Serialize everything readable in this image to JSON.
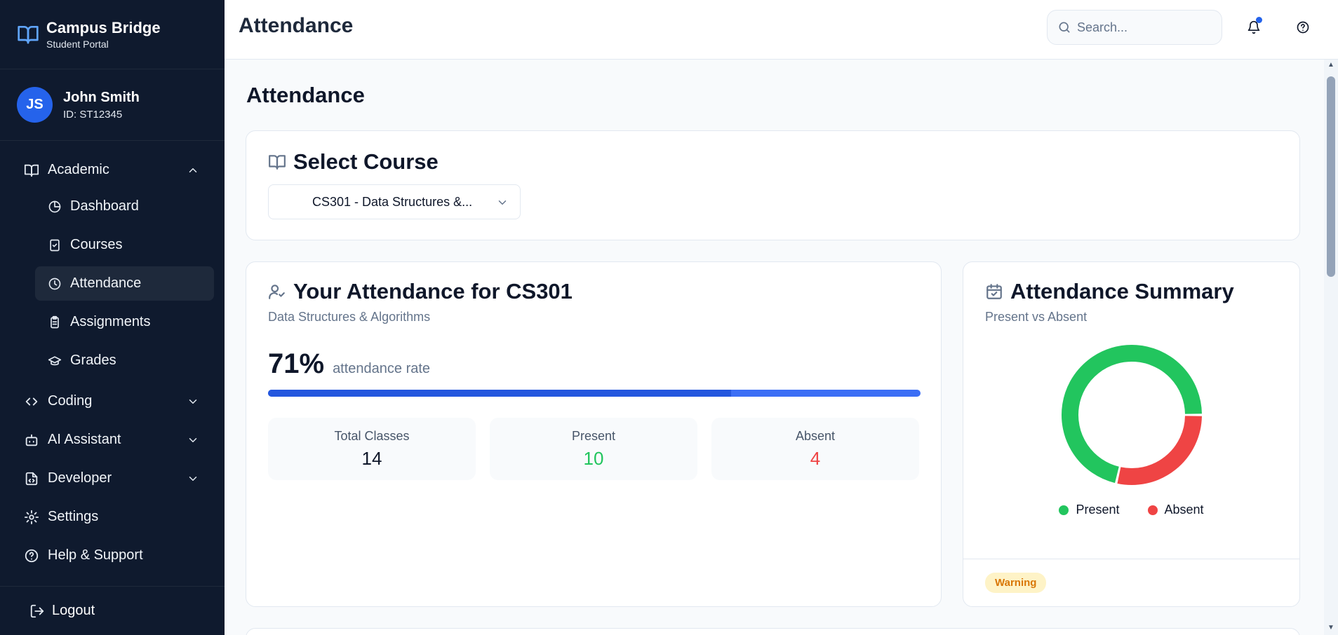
{
  "brand": {
    "title": "Campus Bridge",
    "subtitle": "Student Portal",
    "icon": "book-open-icon"
  },
  "user": {
    "initials": "JS",
    "name": "John Smith",
    "id": "ID: ST12345"
  },
  "sidebar": {
    "groups": [
      {
        "label": "Academic",
        "icon": "book-open-icon",
        "expanded": true
      },
      {
        "label": "Coding",
        "icon": "code-icon",
        "expanded": false
      },
      {
        "label": "AI Assistant",
        "icon": "bot-icon",
        "expanded": false
      },
      {
        "label": "Developer",
        "icon": "file-code-icon",
        "expanded": false
      },
      {
        "label": "Settings",
        "icon": "gear-icon"
      },
      {
        "label": "Help & Support",
        "icon": "help-circle-icon"
      }
    ],
    "academic_items": [
      {
        "label": "Dashboard",
        "icon": "pie-chart-icon"
      },
      {
        "label": "Courses",
        "icon": "notebook-icon"
      },
      {
        "label": "Attendance",
        "icon": "clock-icon",
        "active": true
      },
      {
        "label": "Assignments",
        "icon": "clipboard-icon"
      },
      {
        "label": "Grades",
        "icon": "graduation-cap-icon"
      }
    ],
    "logout": "Logout"
  },
  "header": {
    "title": "Attendance",
    "search_placeholder": "Search..."
  },
  "main": {
    "page_title": "Attendance",
    "select_course": {
      "title": "Select Course",
      "selected": "CS301 - Data Structures &..."
    },
    "attendance_card": {
      "title": "Your Attendance for CS301",
      "subtitle": "Data Structures & Algorithms",
      "rate": "71%",
      "rate_label": "attendance rate",
      "rate_fraction": 0.71,
      "stats": [
        {
          "label": "Total Classes",
          "value": "14"
        },
        {
          "label": "Present",
          "value": "10"
        },
        {
          "label": "Absent",
          "value": "4"
        }
      ]
    },
    "summary_card": {
      "title": "Attendance Summary",
      "subtitle": "Present vs Absent",
      "legend_present": "Present",
      "legend_absent": "Absent",
      "status_badge": "Warning"
    }
  },
  "chart_data": {
    "type": "pie",
    "donut": true,
    "categories": [
      "Present",
      "Absent"
    ],
    "values": [
      10,
      4
    ],
    "colors": [
      "#22c55e",
      "#ef4444"
    ],
    "legend_position": "bottom"
  },
  "colors": {
    "sidebar_bg": "#0f1a2e",
    "accent": "#2563eb",
    "present": "#22c55e",
    "absent": "#ef4444",
    "warning": "#d97706"
  }
}
